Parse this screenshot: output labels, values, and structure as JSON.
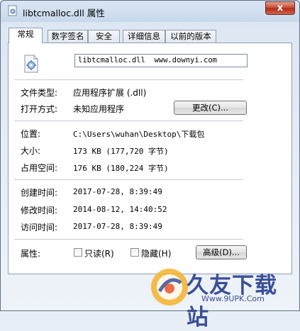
{
  "window": {
    "title": "libtcmalloc.dll 属性",
    "close_label": "x"
  },
  "tabs": [
    {
      "label": "常规"
    },
    {
      "label": "数字签名"
    },
    {
      "label": "安全"
    },
    {
      "label": "详细信息"
    },
    {
      "label": "以前的版本"
    }
  ],
  "general": {
    "filename": "libtcmalloc.dll  www.downyi.com",
    "file_type_label": "文件类型:",
    "file_type_value": "应用程序扩展 (.dll)",
    "open_with_label": "打开方式:",
    "open_with_value": "未知应用程序",
    "change_button": "更改(C)...",
    "location_label": "位置:",
    "location_value": "C:\\Users\\wuhan\\Desktop\\下载包",
    "size_label": "大小:",
    "size_value": "173 KB (177,720 字节)",
    "size_on_disk_label": "占用空间:",
    "size_on_disk_value": "176 KB (180,224 字节)",
    "created_label": "创建时间:",
    "created_value": "2017-07-28, 8:39:49",
    "modified_label": "修改时间:",
    "modified_value": "2014-08-12, 14:40:52",
    "accessed_label": "访问时间:",
    "accessed_value": "2017-07-28, 8:39:49",
    "attributes_label": "属性:",
    "readonly_label": "只读(R)",
    "readonly_checked": false,
    "hidden_label": "隐藏(H)",
    "hidden_checked": false,
    "advanced_button": "高级(D)..."
  },
  "watermark": {
    "text": "久友下载站",
    "url": "Www.9UPK.Com"
  },
  "colors": {
    "accent": "#3a4f97",
    "close_red": "#c4432c"
  }
}
